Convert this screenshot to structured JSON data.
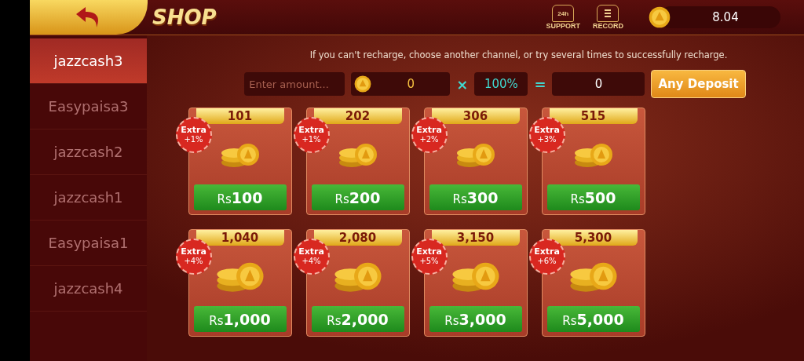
{
  "header": {
    "title": "SHOP",
    "support": {
      "badge": "24h",
      "label": "SUPPORT"
    },
    "record": {
      "label": "RECORD"
    },
    "balance": "8.04"
  },
  "channels": [
    {
      "label": "jazzcash3",
      "selected": true
    },
    {
      "label": "Easypaisa3",
      "selected": false
    },
    {
      "label": "jazzcash2",
      "selected": false
    },
    {
      "label": "jazzcash1",
      "selected": false
    },
    {
      "label": "Easypaisa1",
      "selected": false
    },
    {
      "label": "jazzcash4",
      "selected": false
    }
  ],
  "notice": "If you can't recharge, choose another channel, or try several times to successfully recharge.",
  "calculator": {
    "amount_placeholder": "Enter amount...",
    "coins": "0",
    "times": "×",
    "rate": "100%",
    "equals": "=",
    "result": "0",
    "button": "Any Deposit"
  },
  "packages": [
    {
      "coins": "101",
      "extra": "Extra",
      "bonus": "+1%",
      "currency": "Rs",
      "price": "100"
    },
    {
      "coins": "202",
      "extra": "Extra",
      "bonus": "+1%",
      "currency": "Rs",
      "price": "200"
    },
    {
      "coins": "306",
      "extra": "Extra",
      "bonus": "+2%",
      "currency": "Rs",
      "price": "300"
    },
    {
      "coins": "515",
      "extra": "Extra",
      "bonus": "+3%",
      "currency": "Rs",
      "price": "500"
    },
    {
      "coins": "1,040",
      "extra": "Extra",
      "bonus": "+4%",
      "currency": "Rs",
      "price": "1,000"
    },
    {
      "coins": "2,080",
      "extra": "Extra",
      "bonus": "+4%",
      "currency": "Rs",
      "price": "2,000"
    },
    {
      "coins": "3,150",
      "extra": "Extra",
      "bonus": "+5%",
      "currency": "Rs",
      "price": "3,000"
    },
    {
      "coins": "5,300",
      "extra": "Extra",
      "bonus": "+6%",
      "currency": "Rs",
      "price": "5,000"
    }
  ]
}
